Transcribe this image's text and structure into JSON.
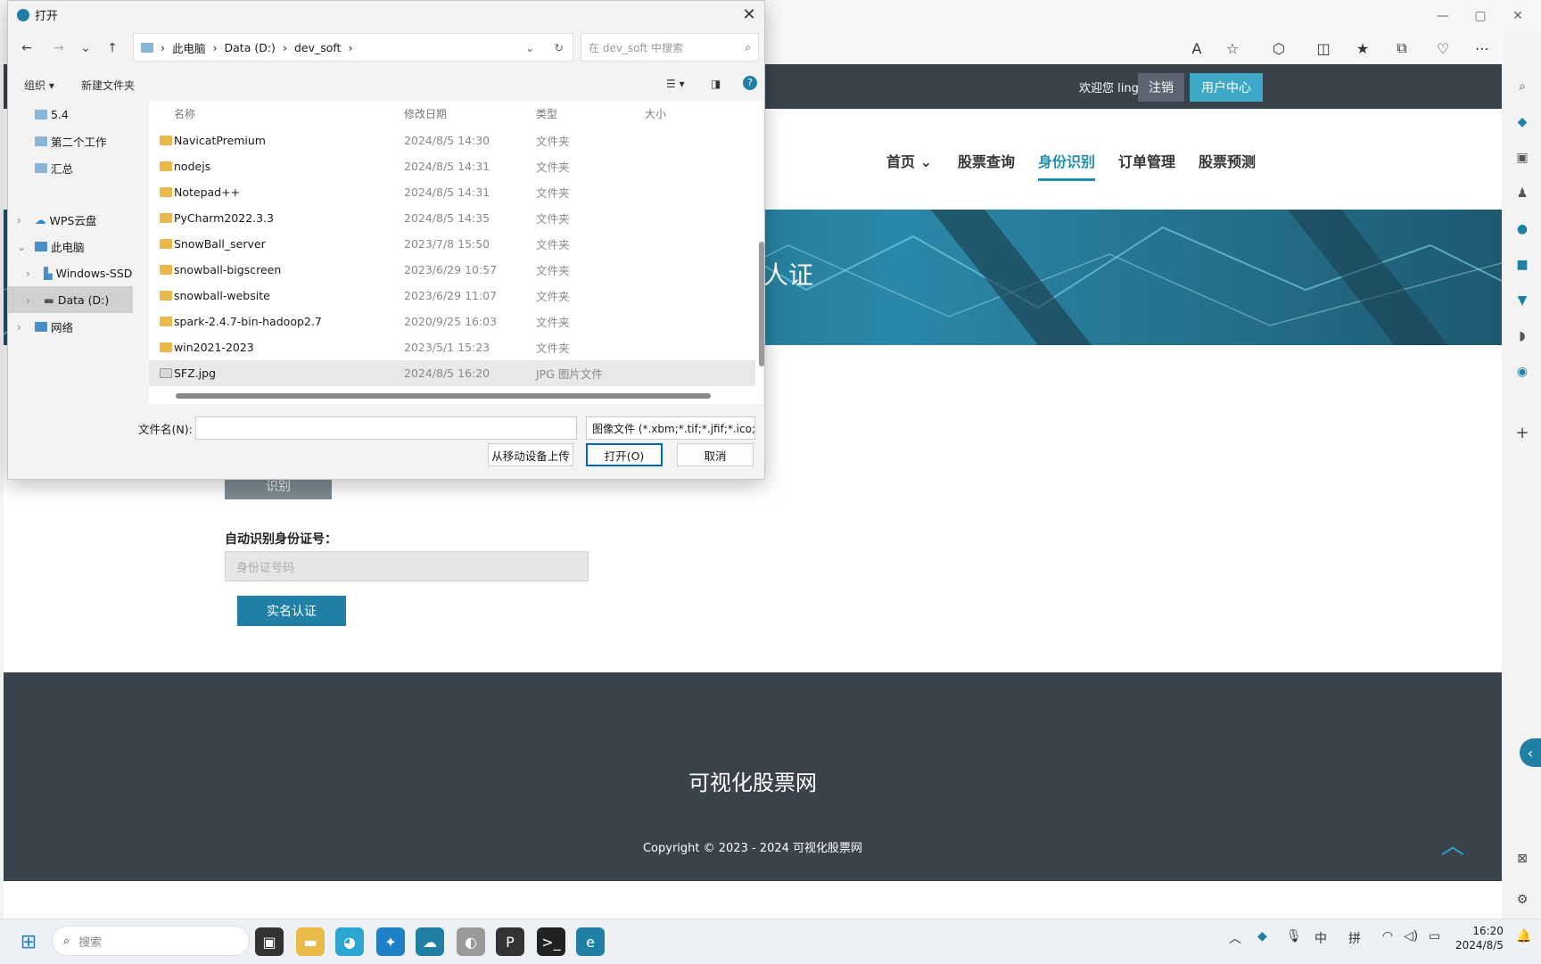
{
  "browser": {
    "toolbar_icons": [
      "read-aloud-icon",
      "favorite-icon",
      "extensions-icon",
      "split-screen-icon",
      "favorites-icon",
      "collections-icon",
      "browser-essentials-icon",
      "more-icon",
      "copilot-icon"
    ],
    "side_rail_icons": [
      "search-icon",
      "tag-icon",
      "briefcase-icon",
      "games-icon",
      "m365-icon",
      "outlook-icon",
      "shopping-icon",
      "drop-icon",
      "spotify-icon",
      "add-icon",
      "screenshot-icon",
      "settings-icon"
    ]
  },
  "site": {
    "welcome": "欢迎您 ling",
    "logout": "注销",
    "user_center": "用户中心",
    "nav": [
      {
        "label": "首页",
        "has_dropdown": true,
        "active": false
      },
      {
        "label": "股票查询",
        "active": false
      },
      {
        "label": "身份识别",
        "active": true
      },
      {
        "label": "订单管理",
        "active": false
      },
      {
        "label": "股票预测",
        "active": false
      }
    ],
    "banner_text": "人证",
    "recognize_button": "识别",
    "id_label": "自动识别身份证号：",
    "id_placeholder": "身份证号码",
    "verify_button": "实名认证",
    "footer_title": "可视化股票网",
    "copyright": "Copyright © 2023 - 2024 可视化股票网"
  },
  "dialog": {
    "title": "打开",
    "path": [
      "此电脑",
      "Data (D:)",
      "dev_soft"
    ],
    "search_placeholder": "在 dev_soft 中搜索",
    "organize": "组织 ▾",
    "new_folder": "新建文件夹",
    "nav_items": [
      {
        "label": "5.4",
        "indent": 1
      },
      {
        "label": "第二个工作",
        "indent": 1
      },
      {
        "label": "汇总",
        "indent": 1
      },
      {
        "label": "WPS云盘",
        "indent": 0,
        "expander": ">"
      },
      {
        "label": "此电脑",
        "indent": 0,
        "expander": "v"
      },
      {
        "label": "Windows-SSD",
        "indent": 1,
        "expander": ">"
      },
      {
        "label": "Data (D:)",
        "indent": 1,
        "expander": ">",
        "selected": true
      },
      {
        "label": "网络",
        "indent": 0,
        "expander": ">"
      }
    ],
    "columns": {
      "name": "名称",
      "date": "修改日期",
      "type": "类型",
      "size": "大小"
    },
    "files": [
      {
        "name": "NavicatPremium",
        "date": "2024/8/5 14:30",
        "type": "文件夹"
      },
      {
        "name": "nodejs",
        "date": "2024/8/5 14:31",
        "type": "文件夹"
      },
      {
        "name": "Notepad++",
        "date": "2024/8/5 14:31",
        "type": "文件夹"
      },
      {
        "name": "PyCharm2022.3.3",
        "date": "2024/8/5 14:35",
        "type": "文件夹"
      },
      {
        "name": "SnowBall_server",
        "date": "2023/7/8 15:50",
        "type": "文件夹"
      },
      {
        "name": "snowball-bigscreen",
        "date": "2023/6/29 10:57",
        "type": "文件夹"
      },
      {
        "name": "snowball-website",
        "date": "2023/6/29 11:07",
        "type": "文件夹"
      },
      {
        "name": "spark-2.4.7-bin-hadoop2.7",
        "date": "2020/9/25 16:03",
        "type": "文件夹"
      },
      {
        "name": "win2021-2023",
        "date": "2023/5/1 15:23",
        "type": "文件夹"
      },
      {
        "name": "SFZ.jpg",
        "date": "2024/8/5 16:20",
        "type": "JPG 图片文件",
        "selected": true
      }
    ],
    "filename_label": "文件名(N):",
    "filename_value": "",
    "filter": "图像文件 (*.xbm;*.tif;*.jfif;*.ico;",
    "upload_mobile": "从移动设备上传",
    "open_button": "打开(O)",
    "cancel_button": "取消"
  },
  "taskbar": {
    "search_placeholder": "搜索",
    "ime_lang": "中",
    "ime_mode": "拼",
    "time": "16:20",
    "date": "2024/8/5"
  }
}
